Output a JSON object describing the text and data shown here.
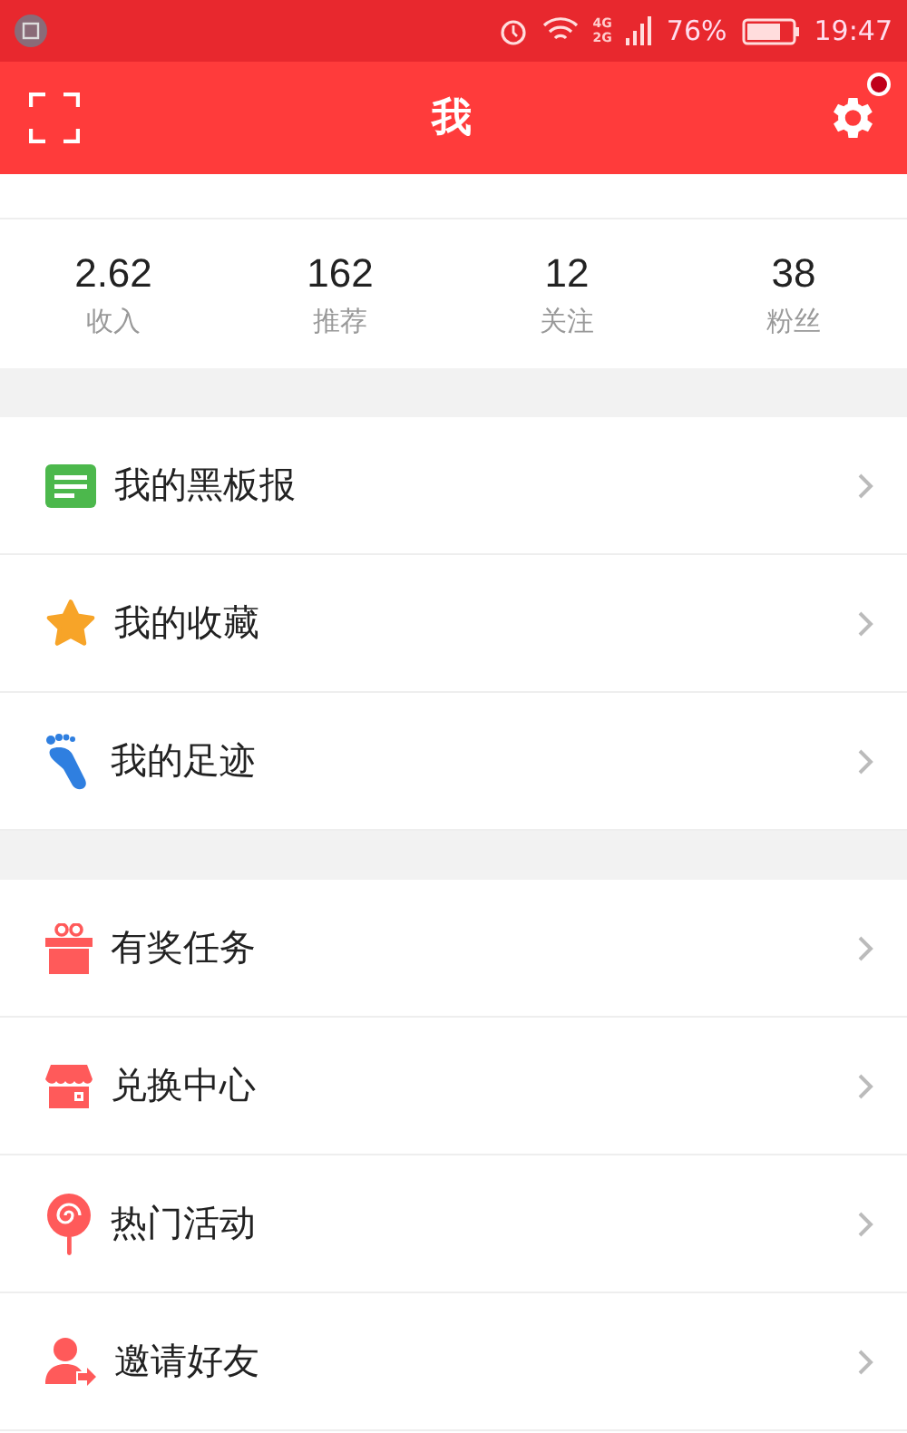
{
  "status_bar": {
    "network_top": "4G",
    "network_bottom": "2G",
    "battery": "76%",
    "time": "19:47"
  },
  "header": {
    "title": "我",
    "settings_badge": true
  },
  "stats": [
    {
      "value": "2.62",
      "label": "收入"
    },
    {
      "value": "162",
      "label": "推荐"
    },
    {
      "value": "12",
      "label": "关注"
    },
    {
      "value": "38",
      "label": "粉丝"
    }
  ],
  "sections": [
    {
      "items": [
        {
          "kind": "blackboard",
          "label": "我的黑板报"
        },
        {
          "kind": "star",
          "label": "我的收藏"
        },
        {
          "kind": "footprint",
          "label": "我的足迹"
        }
      ]
    },
    {
      "items": [
        {
          "kind": "gift",
          "label": "有奖任务"
        },
        {
          "kind": "shop",
          "label": "兑换中心"
        },
        {
          "kind": "lollipop",
          "label": "热门活动"
        },
        {
          "kind": "invite",
          "label": "邀请好友"
        }
      ]
    }
  ]
}
